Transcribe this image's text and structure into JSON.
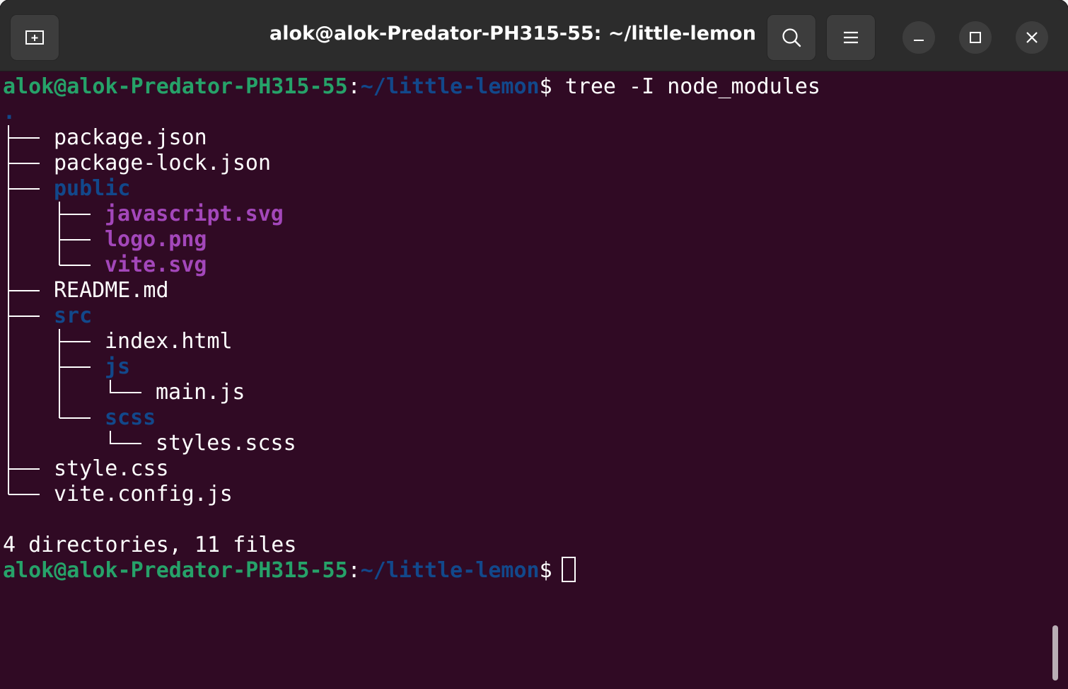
{
  "window": {
    "title": "alok@alok-Predator-PH315-55: ~/little-lemon"
  },
  "prompt": {
    "user_host": "alok@alok-Predator-PH315-55",
    "sep": ":",
    "path": "~/little-lemon",
    "symbol": "$"
  },
  "command": " tree -I node_modules",
  "tree": {
    "root": ".",
    "items": [
      {
        "name": "package.json",
        "kind": "file"
      },
      {
        "name": "package-lock.json",
        "kind": "file"
      },
      {
        "name": "public",
        "kind": "dir"
      },
      {
        "name": "javascript.svg",
        "kind": "image"
      },
      {
        "name": "logo.png",
        "kind": "image"
      },
      {
        "name": "vite.svg",
        "kind": "image"
      },
      {
        "name": "README.md",
        "kind": "file"
      },
      {
        "name": "src",
        "kind": "dir"
      },
      {
        "name": "index.html",
        "kind": "file"
      },
      {
        "name": "js",
        "kind": "dir"
      },
      {
        "name": "main.js",
        "kind": "file"
      },
      {
        "name": "scss",
        "kind": "dir"
      },
      {
        "name": "styles.scss",
        "kind": "file"
      },
      {
        "name": "style.css",
        "kind": "file"
      },
      {
        "name": "vite.config.js",
        "kind": "file"
      }
    ]
  },
  "summary": "4 directories, 11 files",
  "icons": {
    "new_tab": "new-tab-icon",
    "search": "search-icon",
    "menu": "hamburger-menu-icon",
    "minimize": "minimize-icon",
    "maximize": "maximize-icon",
    "close": "close-icon"
  },
  "colors": {
    "terminal_bg": "#300a24",
    "titlebar_bg": "#2c2c2c",
    "user_host": "#26a269",
    "path": "#12488b",
    "image_file": "#a347ba",
    "text": "#ffffff"
  }
}
